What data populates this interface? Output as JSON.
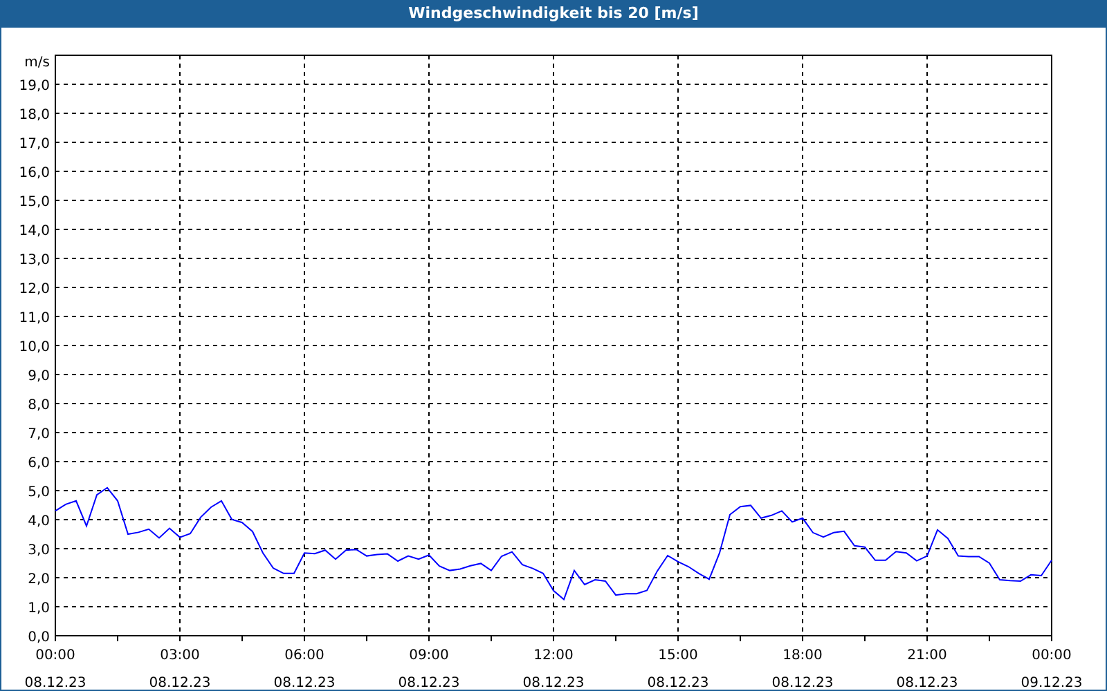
{
  "chart": {
    "chart_data": {
      "type": "line",
      "title": "Windgeschwindigkeit bis 20 [m/s]",
      "ylabel": "m/s",
      "categories": [
        "00:00\n08.12.23",
        null,
        null,
        null,
        null,
        null,
        null,
        null,
        null,
        null,
        null,
        null,
        "03:00\n08.12.23",
        null,
        null,
        null,
        null,
        null,
        null,
        null,
        null,
        null,
        null,
        null,
        "06:00\n08.12.23",
        null,
        null,
        null,
        null,
        null,
        null,
        null,
        null,
        null,
        null,
        null,
        "09:00\n08.12.23",
        null,
        null,
        null,
        null,
        null,
        null,
        null,
        null,
        null,
        null,
        null,
        "12:00\n08.12.23",
        null,
        null,
        null,
        null,
        null,
        null,
        null,
        null,
        null,
        null,
        null,
        "15:00\n08.12.23",
        null,
        null,
        null,
        null,
        null,
        null,
        null,
        null,
        null,
        null,
        null,
        "18:00\n08.12.23",
        null,
        null,
        null,
        null,
        null,
        null,
        null,
        null,
        null,
        null,
        null,
        "21:00\n08.12.23",
        null,
        null,
        null,
        null,
        null,
        null,
        null,
        null,
        null,
        null,
        null,
        "00:00\n09.12.23"
      ],
      "series": [
        {
          "color": "#0000ff",
          "values": [
            4.3,
            4.53,
            4.65,
            3.78,
            4.85,
            5.1,
            4.65,
            3.5,
            3.56,
            3.67,
            3.37,
            3.7,
            3.39,
            3.52,
            4.08,
            4.43,
            4.65,
            4.01,
            3.9,
            3.59,
            2.85,
            2.33,
            2.15,
            2.15,
            2.85,
            2.83,
            2.95,
            2.64,
            2.95,
            2.97,
            2.75,
            2.8,
            2.82,
            2.57,
            2.75,
            2.64,
            2.78,
            2.4,
            2.25,
            2.3,
            2.41,
            2.49,
            2.25,
            2.74,
            2.89,
            2.45,
            2.32,
            2.15,
            1.55,
            1.25,
            2.25,
            1.76,
            1.93,
            1.88,
            1.4,
            1.45,
            1.45,
            1.56,
            2.23,
            2.76,
            2.55,
            2.38,
            2.15,
            1.95,
            2.85,
            4.17,
            4.45,
            4.49,
            4.05,
            4.15,
            4.3,
            3.92,
            4.05,
            3.55,
            3.4,
            3.55,
            3.6,
            3.1,
            3.05,
            2.6,
            2.6,
            2.9,
            2.85,
            2.58,
            2.75,
            3.65,
            3.35,
            2.75,
            2.73,
            2.73,
            2.5,
            1.93,
            1.9,
            1.88,
            2.1,
            2.07,
            2.6
          ]
        }
      ],
      "ylim": [
        0,
        20
      ],
      "grid": true,
      "yticks": [
        {
          "value": 0,
          "label": "0,0"
        },
        {
          "value": 1,
          "label": "1,0"
        },
        {
          "value": 2,
          "label": "2,0"
        },
        {
          "value": 3,
          "label": "3,0"
        },
        {
          "value": 4,
          "label": "4,0"
        },
        {
          "value": 5,
          "label": "5,0"
        },
        {
          "value": 6,
          "label": "6,0"
        },
        {
          "value": 7,
          "label": "7,0"
        },
        {
          "value": 8,
          "label": "8,0"
        },
        {
          "value": 9,
          "label": "9,0"
        },
        {
          "value": 10,
          "label": "10,0"
        },
        {
          "value": 11,
          "label": "11,0"
        },
        {
          "value": 12,
          "label": "12,0"
        },
        {
          "value": 13,
          "label": "13,0"
        },
        {
          "value": 14,
          "label": "14,0"
        },
        {
          "value": 15,
          "label": "15,0"
        },
        {
          "value": 16,
          "label": "16,0"
        },
        {
          "value": 17,
          "label": "17,0"
        },
        {
          "value": 18,
          "label": "18,0"
        },
        {
          "value": 19,
          "label": "19,0"
        }
      ]
    }
  }
}
